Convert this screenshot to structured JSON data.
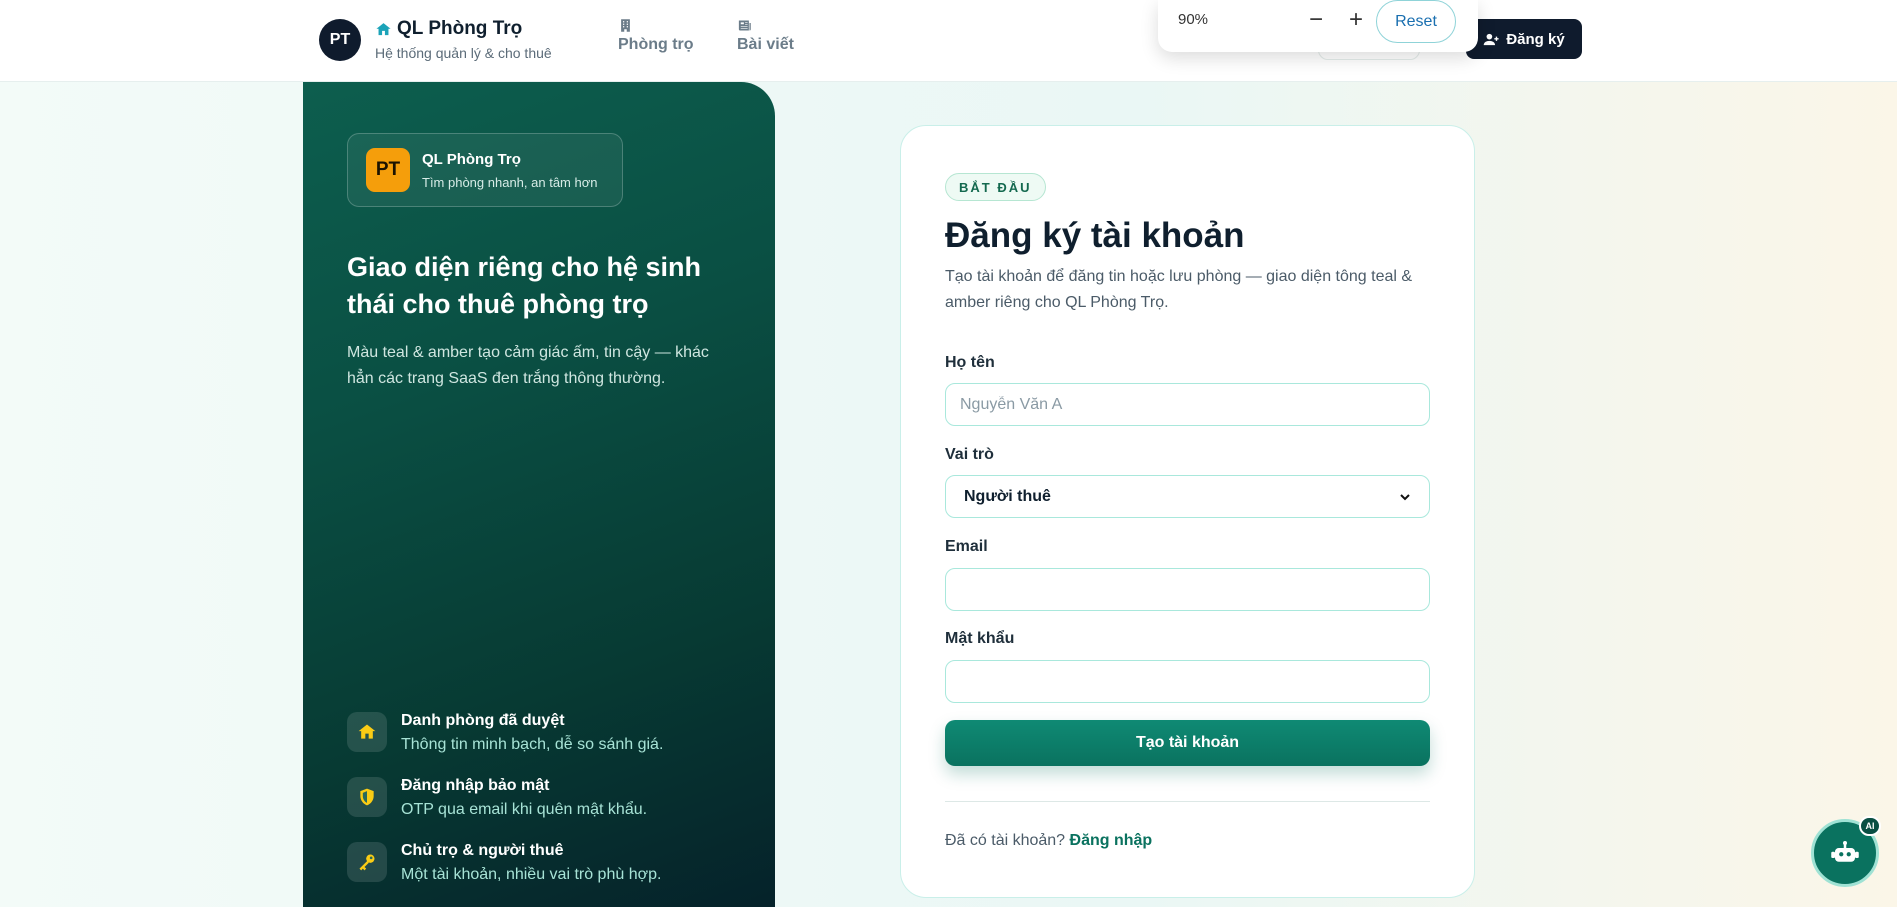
{
  "header": {
    "logo_initials": "PT",
    "brand_title": "QL Phòng Trọ",
    "brand_subtitle": "Hệ thống quản lý & cho thuê",
    "nav": [
      {
        "label": "Phòng trọ",
        "icon": "building-icon"
      },
      {
        "label": "Bài viết",
        "icon": "newspaper-icon"
      }
    ],
    "register_label": "Đăng ký"
  },
  "zoom": {
    "value": "90%",
    "minus": "−",
    "plus": "+",
    "reset_label": "Reset"
  },
  "hero": {
    "card_logo": "PT",
    "card_title": "QL Phòng Trọ",
    "card_subtitle": "Tìm phòng nhanh, an tâm hơn",
    "heading": "Giao diện riêng cho hệ sinh thái cho thuê phòng trọ",
    "description": "Màu teal & amber tạo cảm giác ấm, tin cậy — khác hẳn các trang SaaS đen trắng thông thường.",
    "features": [
      {
        "title": "Danh phòng đã duyệt",
        "subtitle": "Thông tin minh bạch, dễ so sánh giá.",
        "icon": "home-icon"
      },
      {
        "title": "Đăng nhập bảo mật",
        "subtitle": "OTP qua email khi quên mật khẩu.",
        "icon": "shield-icon"
      },
      {
        "title": "Chủ trọ & người thuê",
        "subtitle": "Một tài khoản, nhiều vai trò phù hợp.",
        "icon": "key-icon"
      }
    ]
  },
  "form": {
    "badge": "BẮT ĐẦU",
    "title": "Đăng ký tài khoản",
    "description": "Tạo tài khoản để đăng tin hoặc lưu phòng — giao diện tông teal & amber riêng cho QL Phòng Trọ.",
    "name_label": "Họ tên",
    "name_placeholder": "Nguyễn Văn A",
    "role_label": "Vai trò",
    "role_value": "Người thuê",
    "email_label": "Email",
    "email_value": "",
    "password_label": "Mật khẩu",
    "password_value": "",
    "submit_label": "Tạo tài khoản",
    "login_prompt": "Đã có tài khoản?",
    "login_link": "Đăng nhập"
  },
  "chatbot": {
    "badge": "AI",
    "icon": "robot-icon"
  },
  "colors": {
    "teal": "#0a725f",
    "amber": "#f59e0b",
    "navy": "#0f1b2d"
  }
}
